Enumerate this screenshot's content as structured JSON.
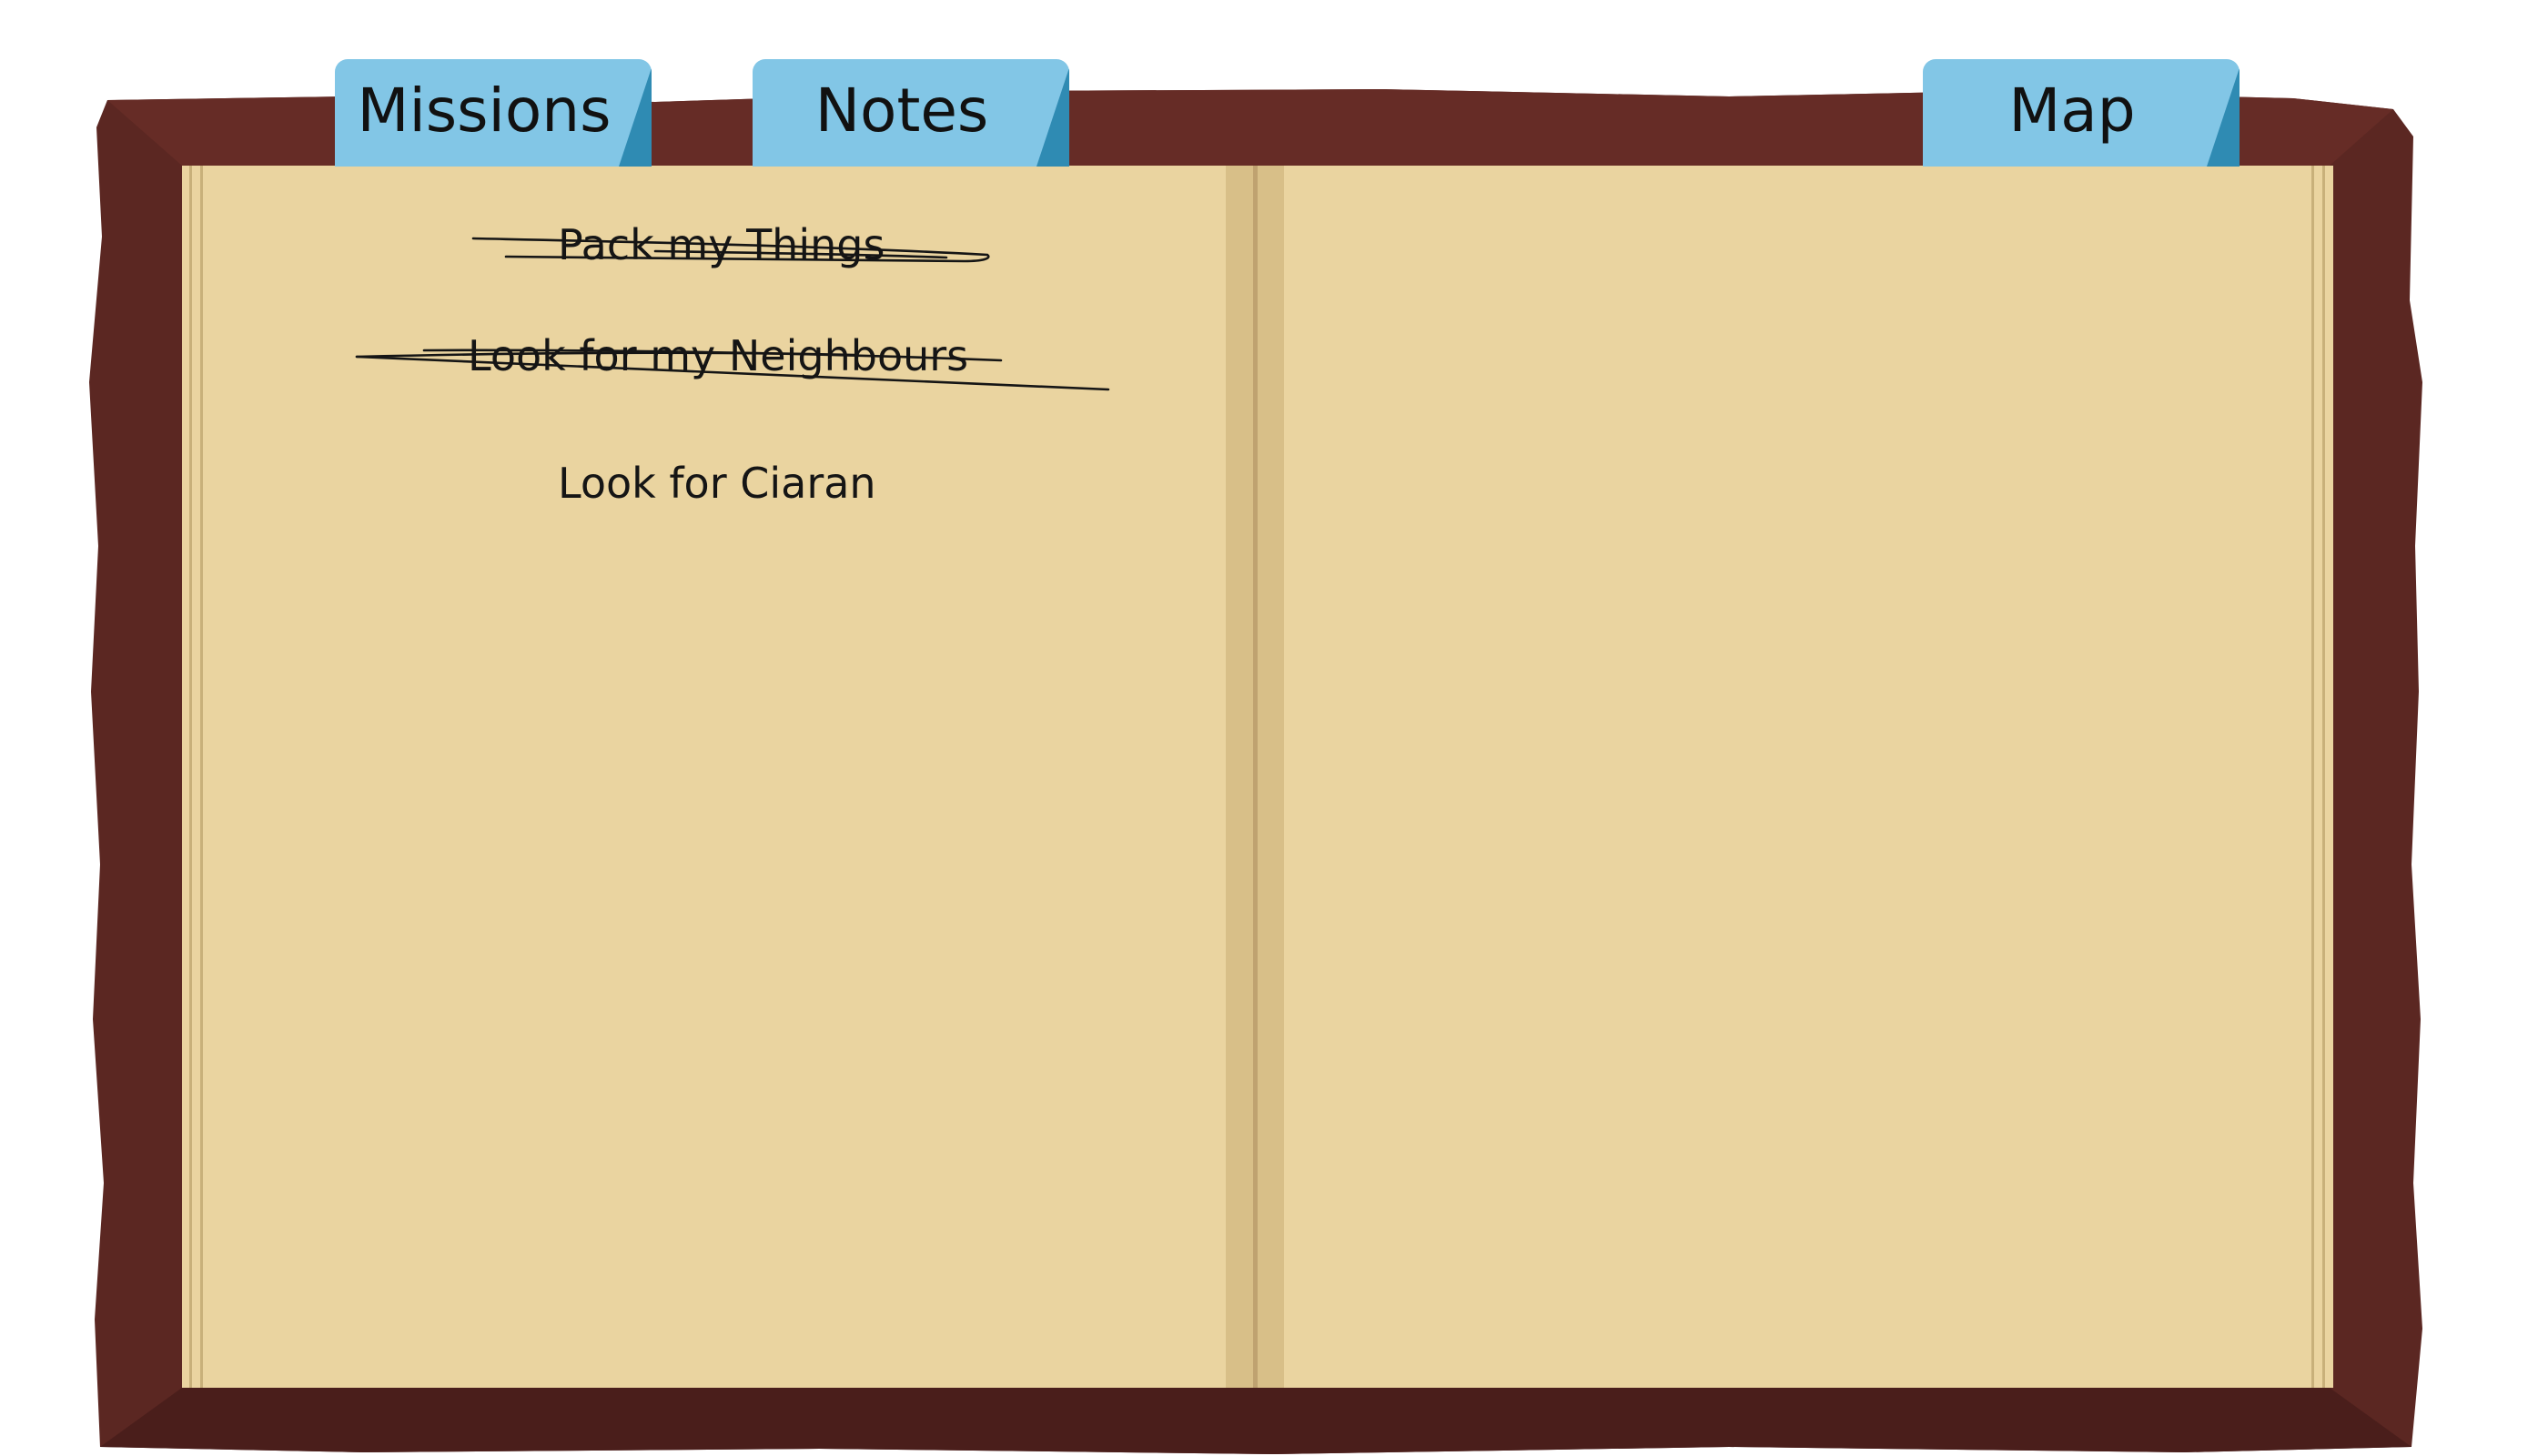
{
  "tabs": [
    {
      "label": "Missions"
    },
    {
      "label": "Notes"
    },
    {
      "label": "Map"
    }
  ],
  "missions": [
    {
      "text": "Pack my Things",
      "completed": true
    },
    {
      "text": "Look for my Neighbours",
      "completed": true
    },
    {
      "text": "Look for Ciaran",
      "completed": false
    }
  ],
  "colors": {
    "cover": "#662c26",
    "page": "#ead4a0",
    "tab": "#82c6e6",
    "tab_fold": "#2f8bb3"
  }
}
